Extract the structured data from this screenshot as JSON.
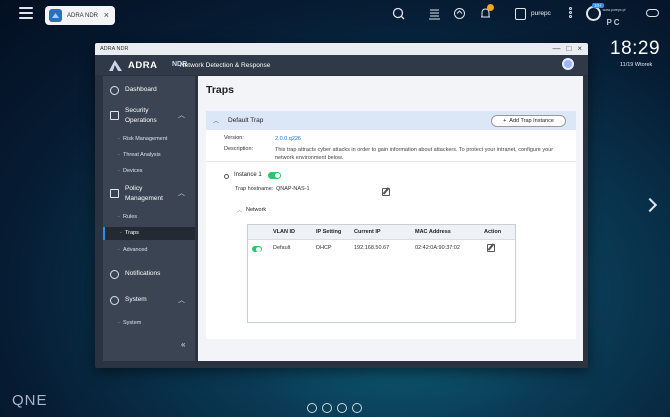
{
  "taskbar": {
    "tab_label": "ADRA NDR",
    "tab_close": "×",
    "user_name": "purepc",
    "badge": "10+"
  },
  "watermark": {
    "text": "PC",
    "sub": "www.purepc.pl"
  },
  "clock": {
    "time": "18:29",
    "date": "11/19 Wtorek"
  },
  "desktop": {
    "brand": "QNE"
  },
  "window": {
    "title": "ADRA NDR",
    "controls": [
      "—",
      "□",
      "×"
    ]
  },
  "app": {
    "brand": "ADRA",
    "brand_sub": "NDR",
    "title": "Network Detection & Response"
  },
  "sidebar": {
    "items": [
      {
        "label": "Dashboard"
      },
      {
        "label": "Security Operations",
        "subitems": [
          "Risk Management",
          "Threat Analysis",
          "Devices"
        ]
      },
      {
        "label": "Policy Management",
        "subitems": [
          "Rules",
          "Traps",
          "Advanced"
        ]
      },
      {
        "label": "Notifications"
      },
      {
        "label": "System",
        "subitems": [
          "System"
        ]
      }
    ],
    "active": "Traps",
    "collapse_label": "«"
  },
  "page": {
    "title": "Traps",
    "section_title": "Default Trap",
    "add_button": "Add Trap Instance",
    "version_label": "Version:",
    "version_value": "2.0.0.q226",
    "description_label": "Description:",
    "description_value": "This trap attracts cyber attacks in order to gain information about attackers. To protect your intranet, configure your network environment below.",
    "instance_label": "Instance 1",
    "instance_enabled": true,
    "hostname_label": "Trap hostname:",
    "hostname_value": "QNAP-NAS-1",
    "network_label": "Network"
  },
  "network_table": {
    "columns": [
      "VLAN ID",
      "IP Setting",
      "Current IP",
      "MAC Address",
      "Action"
    ],
    "rows": [
      {
        "enabled": true,
        "vlan_id": "Default",
        "ip_setting": "DHCP",
        "current_ip": "192.168.50.67",
        "mac": "02:42:0A:90:37:02"
      }
    ]
  },
  "colors": {
    "accent": "#2d8cf0",
    "toggle_on": "#28c76f",
    "link": "#1f6fd1"
  }
}
